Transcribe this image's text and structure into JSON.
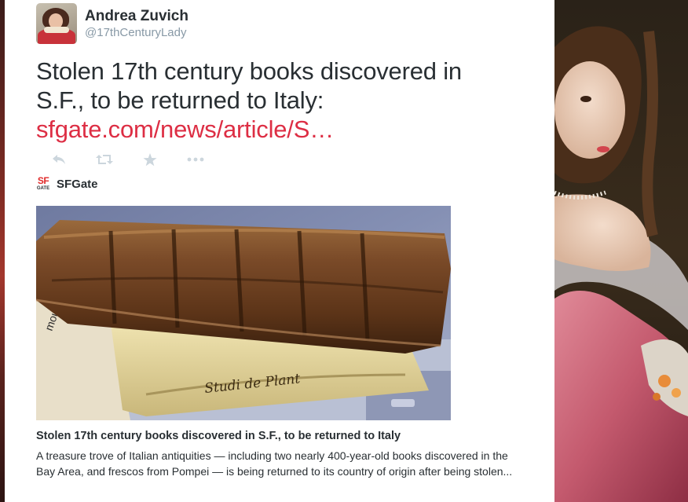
{
  "tweet": {
    "author_name": "Andrea Zuvich",
    "screen_name": "@17thCenturyLady",
    "text": "Stolen 17th century books discovered in S.F., to be returned to Italy:",
    "link_text": "sfgate.com/news/article/S…"
  },
  "actions": {
    "reply_icon": "reply-icon",
    "retweet_icon": "retweet-icon",
    "favorite_icon": "star-icon",
    "more_icon": "more-dots-icon"
  },
  "card": {
    "source_logo_top": "SF",
    "source_logo_bottom": "GATE",
    "source_name": "SFGate",
    "title": "Stolen 17th century books discovered in S.F., to be returned to Italy",
    "description": "A treasure trove of Italian antiquities — including two nearly 400-year-old books discovered in the Bay Area, and frescos from Pompei — is being returned to its country of origin after being stolen...",
    "image_spine_text": "Studi de Plant"
  },
  "colors": {
    "text": "#292f33",
    "link": "#dd2e44",
    "muted": "#8899a6",
    "icon": "#ccd6dd",
    "brand_red": "#e02a2a"
  }
}
